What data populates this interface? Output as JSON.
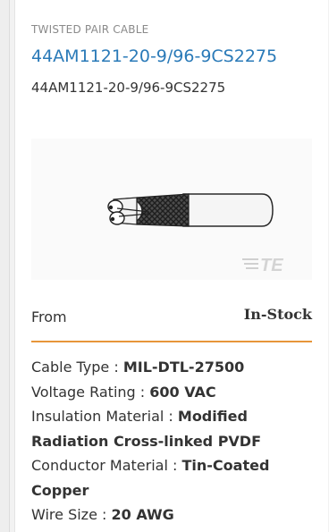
{
  "card": {
    "category": "TWISTED PAIR CABLE",
    "title": "44AM1121-20-9/96-9CS2275",
    "subtitle": "44AM1121-20-9/96-9CS2275",
    "image_watermark": "TE",
    "from_label": "From",
    "stock_status": "In-Stock",
    "specs": [
      {
        "label": "Cable Type :",
        "value": "MIL-DTL-27500"
      },
      {
        "label": "Voltage Rating :",
        "value": "600 VAC"
      },
      {
        "label": "Insulation Material :",
        "value": "Modified Radiation Cross-linked PVDF"
      },
      {
        "label": "Conductor Material :",
        "value": "Tin-Coated Copper"
      },
      {
        "label": "Wire Size :",
        "value": "20 AWG"
      }
    ]
  },
  "colors": {
    "link": "#2a7ab8",
    "divider": "#e7963a"
  }
}
